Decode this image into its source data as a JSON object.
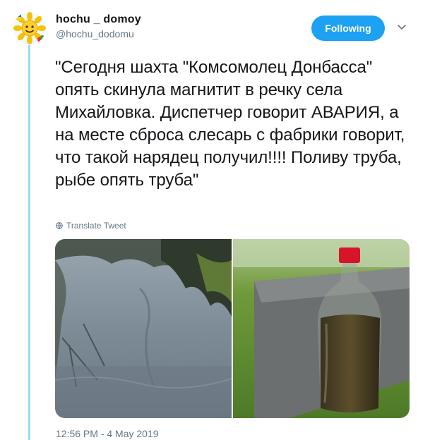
{
  "author": {
    "display_name": "hochu _ domoy",
    "handle": "@hochu_dodomu",
    "avatar_icon": "sunflower-emoji-icon"
  },
  "follow_button": {
    "label": "Following"
  },
  "menu": {
    "icon": "chevron-down-icon"
  },
  "tweet": {
    "text": "\"Сегодня шахта \"Комсомолец Донбасса\" опять скинула магнитит в речку села Михайловка. Диспетчер говорит АВАРИЯ, а на месте сброса слесарь с фабрики говорит, что такой нарядец получил!!!! Поливу труба, рыбе опять труба\"",
    "translate_label": "Translate Tweet",
    "translate_icon": "globe-icon",
    "timestamp": "12:56 PM - 4 May 2019"
  },
  "media": [
    {
      "description_icon": "river-photo"
    },
    {
      "description_icon": "bottle-photo"
    }
  ],
  "colors": {
    "accent": "#1da1f2",
    "thread_line": "#9fd8f5",
    "muted_text": "#657786"
  }
}
